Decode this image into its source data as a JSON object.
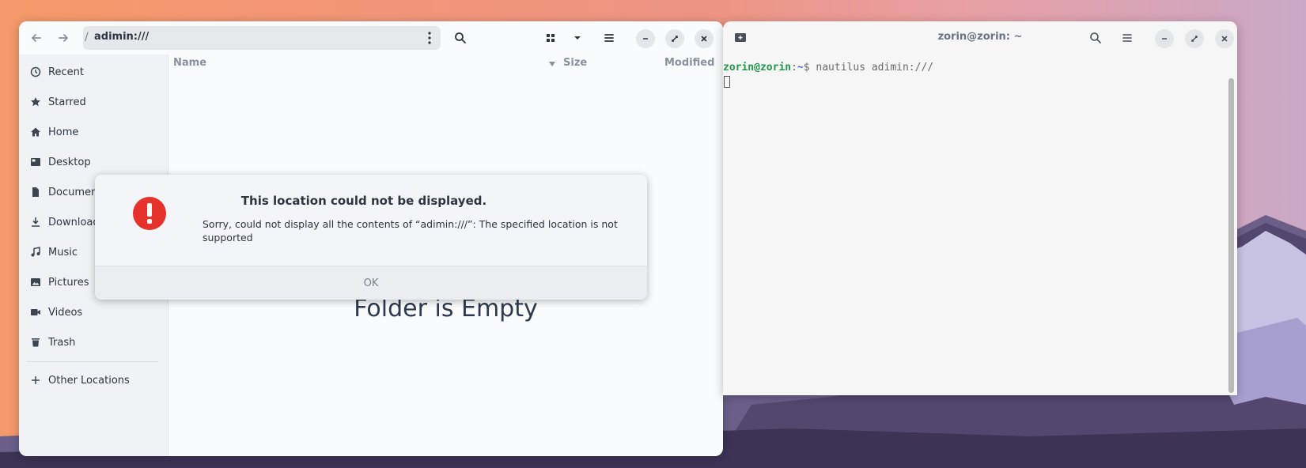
{
  "files_window": {
    "path_label": "adimin:///",
    "path_separator": "/",
    "sidebar": {
      "items": [
        {
          "label": "Recent",
          "icon": "clock-icon"
        },
        {
          "label": "Starred",
          "icon": "star-icon"
        },
        {
          "label": "Home",
          "icon": "home-icon"
        },
        {
          "label": "Desktop",
          "icon": "desktop-icon"
        },
        {
          "label": "Documents",
          "icon": "document-icon"
        },
        {
          "label": "Downloads",
          "icon": "download-icon"
        },
        {
          "label": "Music",
          "icon": "music-icon"
        },
        {
          "label": "Pictures",
          "icon": "picture-icon"
        },
        {
          "label": "Videos",
          "icon": "video-icon"
        },
        {
          "label": "Trash",
          "icon": "trash-icon"
        }
      ],
      "other_locations": "Other Locations"
    },
    "columns": {
      "name": "Name",
      "size": "Size",
      "modified": "Modified"
    },
    "empty_message": "Folder is Empty"
  },
  "dialog": {
    "title": "This location could not be displayed.",
    "message": "Sorry, could not display all the contents of “adimin:///”: The specified location is not supported",
    "ok_label": "OK",
    "icon": "error-icon",
    "error_color": "#e5322d"
  },
  "terminal": {
    "title": "zorin@zorin: ~",
    "prompt_user": "zorin@zorin",
    "prompt_sep": ":",
    "prompt_path": "~",
    "prompt_symbol": "$",
    "command": " nautilus adimin:///"
  }
}
